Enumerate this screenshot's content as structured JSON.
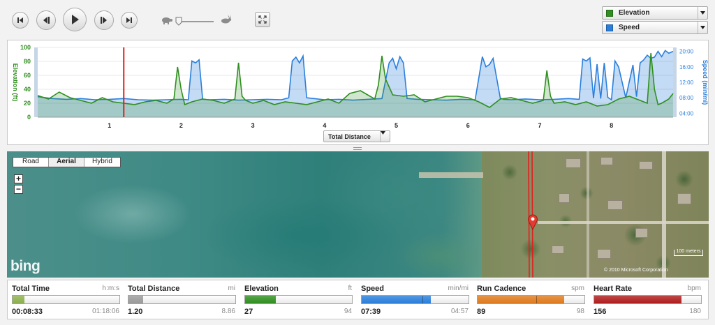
{
  "playback": {
    "buttons": [
      "skip-to-start",
      "step-back",
      "play",
      "step-forward",
      "skip-to-end"
    ]
  },
  "selectors": {
    "primary": {
      "label": "Elevation",
      "color": "#2f8f1f"
    },
    "secondary": {
      "label": "Speed",
      "color": "#2a7fdc"
    }
  },
  "chart": {
    "xaxis_select_label": "Total Distance"
  },
  "chart_data": {
    "type": "area",
    "xlabel": "Total Distance",
    "xticks": [
      "1",
      "2",
      "3",
      "4",
      "5",
      "6",
      "7",
      "8"
    ],
    "y_left": {
      "label": "Elevation (ft)",
      "ticks": [
        "0",
        "20",
        "40",
        "60",
        "80",
        "100"
      ],
      "range": [
        0,
        100
      ]
    },
    "y_right": {
      "label": "Speed (min/mi)",
      "ticks": [
        "04:00",
        "08:00",
        "12:00",
        "16:00",
        "20:00"
      ],
      "range": [
        3,
        21
      ]
    },
    "x_range": [
      0,
      8.86
    ],
    "cursor_x": 1.2,
    "series": [
      {
        "name": "Elevation",
        "axis": "left",
        "color": "#2f8f1f",
        "x": [
          0,
          0.15,
          0.3,
          0.45,
          0.6,
          0.75,
          0.9,
          1.05,
          1.2,
          1.35,
          1.5,
          1.65,
          1.8,
          1.9,
          1.95,
          2.0,
          2.05,
          2.15,
          2.3,
          2.45,
          2.6,
          2.75,
          2.8,
          2.85,
          2.9,
          3.0,
          3.15,
          3.3,
          3.45,
          3.6,
          3.75,
          3.9,
          4.05,
          4.2,
          4.35,
          4.5,
          4.6,
          4.7,
          4.75,
          4.8,
          4.85,
          4.95,
          5.1,
          5.25,
          5.4,
          5.55,
          5.7,
          5.85,
          6.0,
          6.15,
          6.3,
          6.45,
          6.6,
          6.75,
          6.9,
          7.05,
          7.1,
          7.15,
          7.2,
          7.35,
          7.5,
          7.65,
          7.8,
          7.95,
          8.1,
          8.25,
          8.4,
          8.5,
          8.55,
          8.6,
          8.65,
          8.7,
          8.8,
          8.86
        ],
        "values": [
          31,
          26,
          36,
          28,
          24,
          20,
          28,
          22,
          20,
          18,
          22,
          24,
          20,
          26,
          72,
          40,
          18,
          22,
          26,
          24,
          20,
          26,
          78,
          30,
          24,
          20,
          24,
          18,
          22,
          20,
          18,
          22,
          26,
          20,
          34,
          38,
          32,
          26,
          46,
          88,
          55,
          32,
          30,
          32,
          22,
          26,
          30,
          30,
          28,
          22,
          14,
          26,
          28,
          24,
          20,
          24,
          67,
          30,
          20,
          22,
          18,
          22,
          16,
          18,
          26,
          30,
          24,
          20,
          92,
          40,
          18,
          20,
          26,
          34
        ]
      },
      {
        "name": "Speed",
        "axis": "right",
        "color": "#2a7fdc",
        "x": [
          0,
          0.2,
          0.4,
          0.6,
          0.8,
          1.0,
          1.2,
          1.4,
          1.6,
          1.8,
          2.0,
          2.1,
          2.15,
          2.2,
          2.25,
          2.3,
          2.4,
          2.6,
          2.8,
          3.0,
          3.2,
          3.4,
          3.5,
          3.55,
          3.6,
          3.65,
          3.7,
          3.75,
          3.85,
          4.0,
          4.2,
          4.4,
          4.6,
          4.8,
          4.9,
          4.95,
          5.0,
          5.05,
          5.1,
          5.15,
          5.3,
          5.5,
          5.7,
          5.9,
          6.1,
          6.2,
          6.25,
          6.3,
          6.35,
          6.45,
          6.5,
          6.6,
          6.8,
          7.0,
          7.2,
          7.4,
          7.55,
          7.6,
          7.65,
          7.7,
          7.75,
          7.8,
          7.85,
          7.9,
          7.95,
          8.0,
          8.05,
          8.1,
          8.2,
          8.3,
          8.35,
          8.4,
          8.45,
          8.5,
          8.55,
          8.6,
          8.65,
          8.7,
          8.75,
          8.8,
          8.86
        ],
        "values": [
          8.3,
          7.8,
          7.6,
          7.8,
          7.5,
          7.6,
          7.8,
          7.5,
          7.4,
          7.5,
          7.6,
          7.5,
          17.5,
          17.0,
          17.8,
          7.6,
          7.5,
          7.6,
          7.4,
          7.5,
          7.6,
          7.5,
          8.0,
          17.5,
          18.5,
          17.0,
          18.8,
          8.0,
          7.8,
          7.5,
          7.6,
          7.4,
          7.6,
          7.8,
          17.0,
          18.2,
          15.5,
          18.6,
          17.0,
          7.8,
          7.6,
          7.5,
          7.4,
          7.6,
          7.5,
          18.6,
          16.0,
          16.6,
          18.2,
          7.9,
          7.6,
          7.5,
          7.7,
          7.5,
          7.6,
          7.8,
          7.6,
          18.0,
          17.5,
          18.3,
          7.9,
          16.7,
          7.8,
          17.0,
          8.1,
          7.5,
          17.5,
          16.0,
          8.0,
          16.5,
          8.3,
          17.0,
          17.8,
          19.0,
          18.2,
          18.5,
          20.0,
          18.6,
          20.2,
          19.5,
          20.0
        ]
      }
    ]
  },
  "map": {
    "types": [
      "Road",
      "Aerial",
      "Hybrid"
    ],
    "selected_type": "Aerial",
    "zoom_in": "+",
    "zoom_out": "−",
    "provider": "bing",
    "scale": "100 meters",
    "copyright": "© 2010 Microsoft Corporation"
  },
  "stats": [
    {
      "label": "Total Time",
      "unit": "h:m:s",
      "value": "00:08:33",
      "max": "01:18:06",
      "color": "#8db04c",
      "fill": 0.11,
      "marker": null
    },
    {
      "label": "Total Distance",
      "unit": "mi",
      "value": "1.20",
      "max": "8.86",
      "color": "#9a9a9a",
      "fill": 0.135,
      "marker": null
    },
    {
      "label": "Elevation",
      "unit": "ft",
      "value": "27",
      "max": "94",
      "color": "#2f8f1f",
      "fill": 0.287,
      "marker": null
    },
    {
      "label": "Speed",
      "unit": "min/mi",
      "value": "07:39",
      "max": "04:57",
      "color": "#2a7fdc",
      "fill": 0.65,
      "marker": 0.57
    },
    {
      "label": "Run Cadence",
      "unit": "spm",
      "value": "89",
      "max": "98",
      "color": "#e07a1c",
      "fill": 0.81,
      "marker": 0.55
    },
    {
      "label": "Heart Rate",
      "unit": "bpm",
      "value": "156",
      "max": "180",
      "color": "#b01c1c",
      "fill": 0.82,
      "marker": null
    }
  ]
}
